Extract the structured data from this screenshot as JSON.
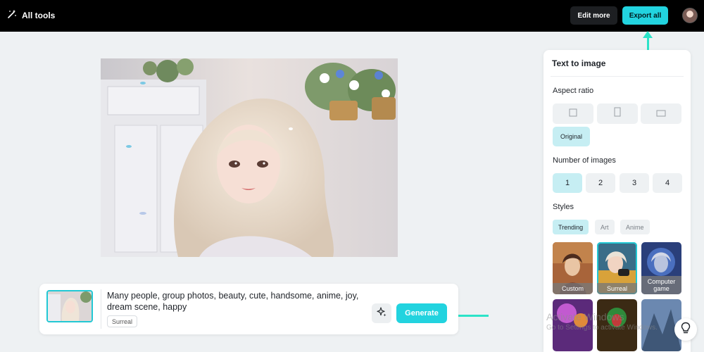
{
  "topbar": {
    "all_tools_label": "All tools",
    "edit_more_label": "Edit more",
    "export_all_label": "Export all"
  },
  "prompt": {
    "text": "Many people, group photos, beauty, cute, handsome, anime, joy, dream scene, happy",
    "style_tag": "Surreal",
    "generate_label": "Generate"
  },
  "panel": {
    "title": "Text to image",
    "aspect_ratio_label": "Aspect ratio",
    "aspect_ratio_selected": "Original",
    "number_of_images_label": "Number of images",
    "number_options": [
      "1",
      "2",
      "3",
      "4"
    ],
    "number_selected": "1",
    "styles_label": "Styles",
    "style_tabs": [
      "Trending",
      "Art",
      "Anime"
    ],
    "style_tab_selected": "Trending",
    "style_cards": [
      {
        "label": "Custom"
      },
      {
        "label": "Surreal"
      },
      {
        "label": "Computer game"
      }
    ]
  },
  "watermark": {
    "title": "Activate Windows",
    "subtitle": "Go to Settings to activate Windows."
  },
  "icons": {
    "all_tools": "magic-wand-icon",
    "magic": "sparkle-icon",
    "help": "lightbulb-icon"
  },
  "colors": {
    "accent": "#22d3df",
    "accent_light": "#c6eef3",
    "annotation_arrow": "#2ce3c8",
    "topbar": "#000000"
  }
}
